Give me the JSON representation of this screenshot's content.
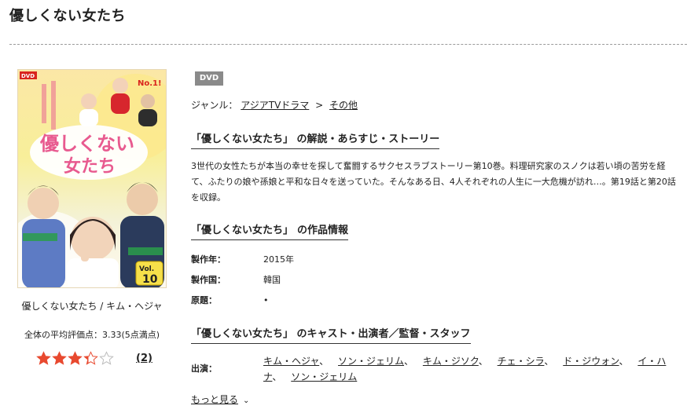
{
  "page": {
    "title": "優しくない女たち"
  },
  "item": {
    "caption": "優しくない女たち / キム・ヘジャ",
    "avg_rating_text": "全体の平均評価点：3.33(5点満点)",
    "rating": 3.33,
    "rating_max": 5,
    "review_count": "(2)",
    "cover": {
      "dvd_label": "DVD",
      "title_line1": "優しくない",
      "title_line2": "女たち",
      "vol_label": "Vol.",
      "vol_number": "10",
      "no1_label": "No.1!"
    }
  },
  "badge": {
    "label": "DVD"
  },
  "genre": {
    "label": "ジャンル：",
    "path": [
      "アジアTVドラマ",
      "その他"
    ],
    "separator": ">"
  },
  "sections": {
    "synopsis_heading": "「優しくない女たち」 の解説・あらすじ・ストーリー",
    "synopsis_text": "3世代の女性たちが本当の幸せを探して奮闘するサクセスラブストーリー第10巻。料理研究家のスノクは若い頃の苦労を経て、ふたりの娘や孫娘と平和な日々を送っていた。そんなある日、4人それぞれの人生に一大危機が訪れ…。第19話と第20話を収録。",
    "info_heading_prefix": "「優しくない女たち」",
    "info_heading_suffix": "の作品情報",
    "cast_heading": "「優しくない女たち」 のキャスト・出演者／監督・スタッフ"
  },
  "info": [
    {
      "label": "製作年：",
      "value": "2015年"
    },
    {
      "label": "製作国：",
      "value": "韓国"
    },
    {
      "label": "原題：",
      "value": "•"
    }
  ],
  "cast": {
    "label": "出演：",
    "names": [
      "キム・ヘジャ",
      "ソン・ジェリム",
      "キム・ジソク",
      "チェ・シラ",
      "ド・ジウォン",
      "イ・ハナ",
      "ソン・ジェリム"
    ],
    "separator": "、"
  },
  "more": {
    "label": "もっと見る"
  },
  "colors": {
    "star_fill": "#e8492f",
    "star_empty": "#bbbbbb",
    "badge_bg": "#8a8a8a"
  }
}
